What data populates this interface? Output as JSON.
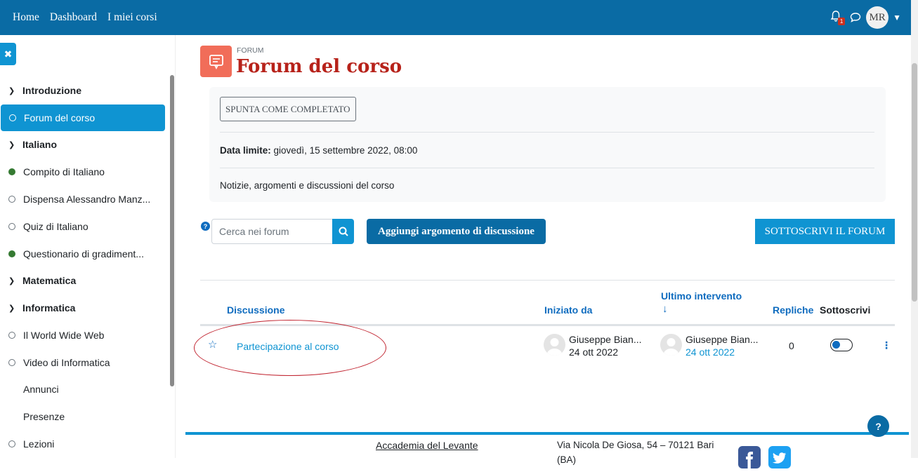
{
  "nav": {
    "links": [
      "Home",
      "Dashboard",
      "I miei corsi"
    ],
    "notification_count": "1",
    "user_initials": "MR"
  },
  "drawer": {
    "sections": [
      {
        "label": "Introduzione"
      },
      {
        "label": "Italiano"
      },
      {
        "label": "Matematica"
      },
      {
        "label": "Informatica"
      }
    ],
    "items": [
      {
        "label": "Forum del corso",
        "status": "active"
      },
      {
        "label": "Compito di Italiano",
        "status": "done"
      },
      {
        "label": "Dispensa Alessandro Manz...",
        "status": "todo"
      },
      {
        "label": "Quiz di Italiano",
        "status": "todo"
      },
      {
        "label": "Questionario di gradiment...",
        "status": "done"
      },
      {
        "label": "Il World Wide Web",
        "status": "todo"
      },
      {
        "label": "Video di Informatica",
        "status": "todo"
      },
      {
        "label": "Annunci",
        "status": "none"
      },
      {
        "label": "Presenze",
        "status": "none"
      },
      {
        "label": "Lezioni",
        "status": "todo"
      }
    ]
  },
  "header": {
    "kicker": "FORUM",
    "title": "Forum del corso"
  },
  "info": {
    "complete_button": "SPUNTA COME COMPLETATO",
    "deadline_label": "Data limite:",
    "deadline_value": "giovedì, 15 settembre 2022, 08:00",
    "description": "Notizie, argomenti e discussioni del corso"
  },
  "toolbar": {
    "search_placeholder": "Cerca nei forum",
    "add_button": "Aggiungi argomento di discussione",
    "subscribe_button": "SOTTOSCRIVI IL FORUM"
  },
  "table": {
    "headers": {
      "discussion": "Discussione",
      "started_by": "Iniziato da",
      "last_post": "Ultimo intervento",
      "last_post_arrow": "↓",
      "replies": "Repliche",
      "subscribe": "Sottoscrivi"
    },
    "rows": [
      {
        "title": "Partecipazione al corso",
        "started_by": "Giuseppe Bian...",
        "started_date": "24 ott 2022",
        "last_by": "Giuseppe Bian...",
        "last_date": "24 ott 2022",
        "replies": "0"
      }
    ]
  },
  "footer": {
    "name": "Accademia del Levante",
    "address": "Via Nicola De Giosa, 54 – 70121 Bari (BA)"
  },
  "help_button": "?"
}
